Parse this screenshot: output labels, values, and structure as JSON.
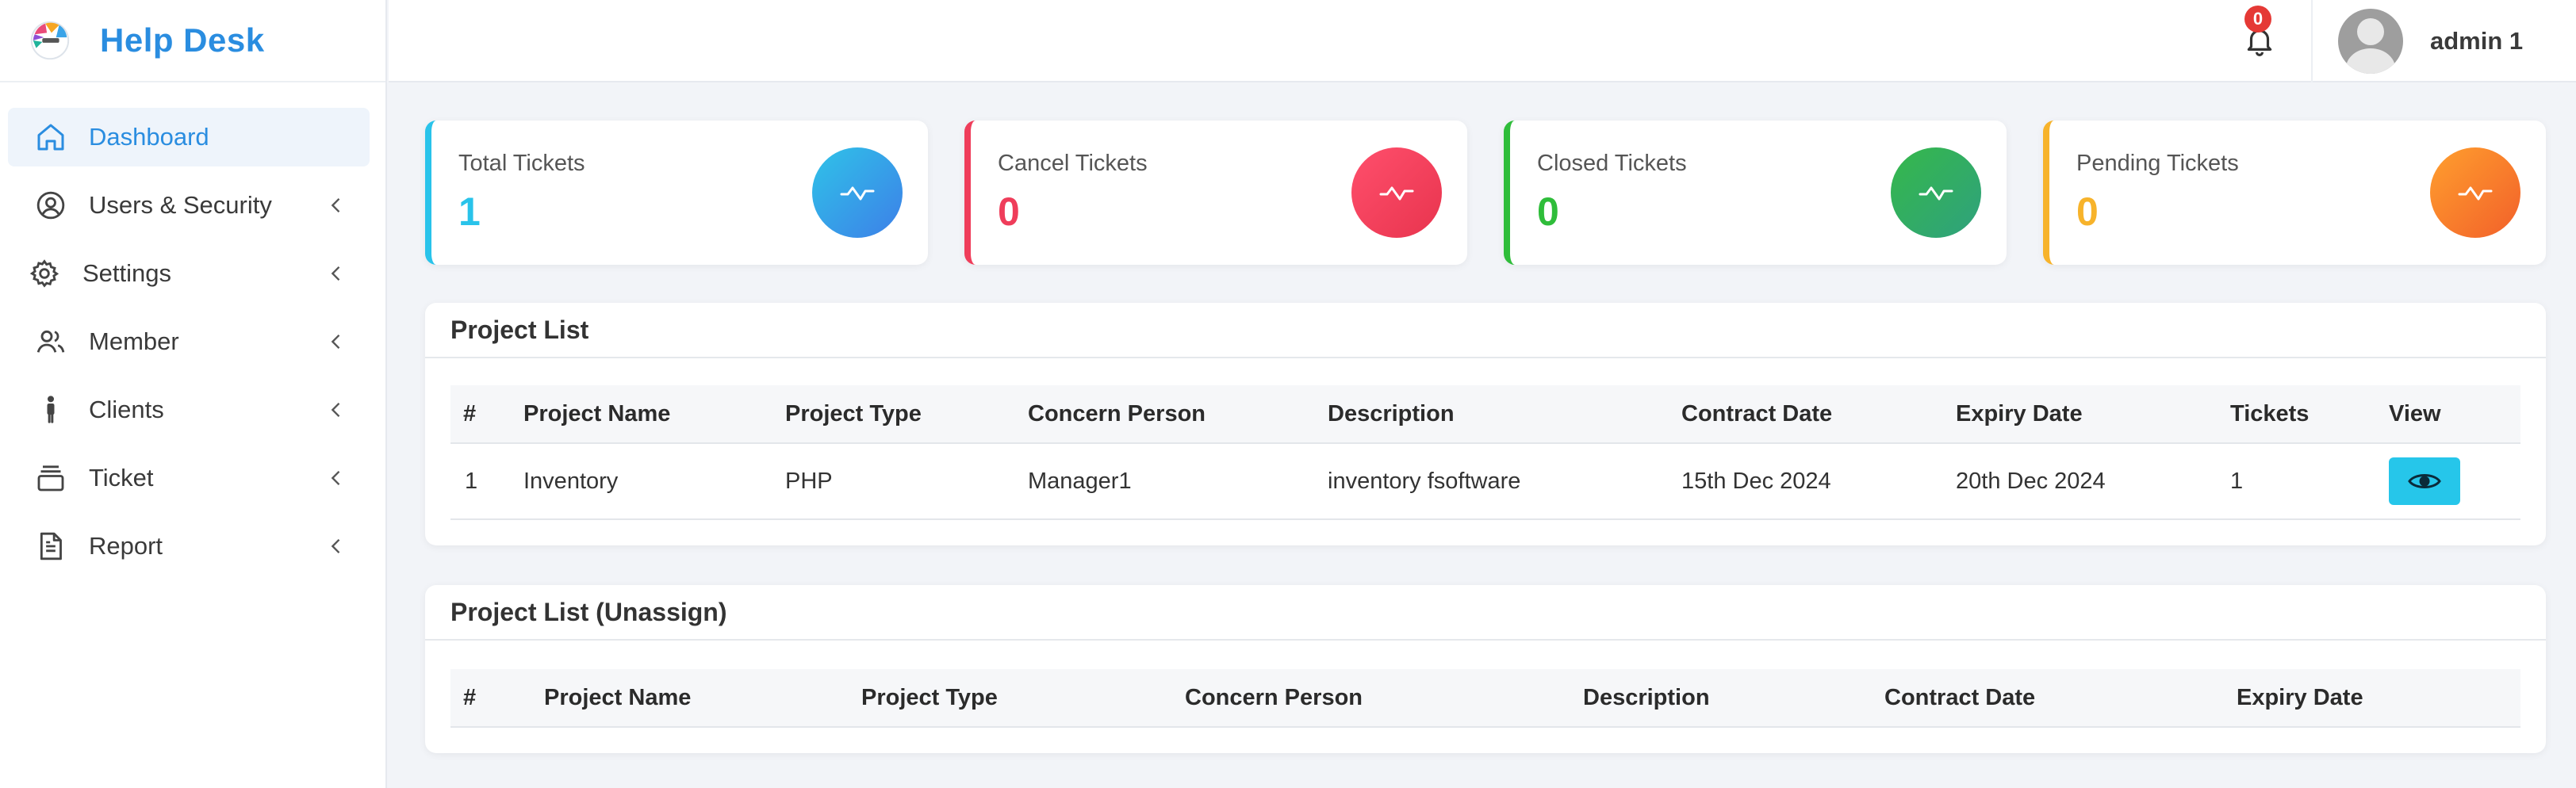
{
  "app": {
    "title": "Help Desk"
  },
  "sidebar": {
    "items": [
      {
        "label": "Dashboard",
        "icon": "home-icon",
        "active": true
      },
      {
        "label": "Users & Security",
        "icon": "user-circle-icon"
      },
      {
        "label": "Settings",
        "icon": "gear-icon"
      },
      {
        "label": "Member",
        "icon": "users-icon"
      },
      {
        "label": "Clients",
        "icon": "person-standing-icon"
      },
      {
        "label": "Ticket",
        "icon": "stack-icon"
      },
      {
        "label": "Report",
        "icon": "document-icon"
      }
    ]
  },
  "header": {
    "notifications_count": "0",
    "user_name": "admin 1"
  },
  "stats": [
    {
      "label": "Total Tickets",
      "value": "1",
      "color": "#29c3ea",
      "gradient": [
        "#2fc3e8",
        "#3d7fe8"
      ]
    },
    {
      "label": "Cancel Tickets",
      "value": "0",
      "color": "#ef3d5a",
      "gradient": [
        "#ff4f6c",
        "#e8344e"
      ]
    },
    {
      "label": "Closed Tickets",
      "value": "0",
      "color": "#2fbd3a",
      "gradient": [
        "#35b84a",
        "#2fa17e"
      ]
    },
    {
      "label": "Pending Tickets",
      "value": "0",
      "color": "#f7b32b",
      "gradient": [
        "#ff9f2e",
        "#f2602a"
      ]
    }
  ],
  "project_list": {
    "title": "Project List",
    "columns": [
      "#",
      "Project Name",
      "Project Type",
      "Concern Person",
      "Description",
      "Contract Date",
      "Expiry Date",
      "Tickets",
      "View"
    ],
    "rows": [
      {
        "num": "1",
        "name": "Inventory",
        "type": "PHP",
        "person": "Manager1",
        "description": "inventory fsoftware",
        "contract": "15th Dec 2024",
        "expiry": "20th Dec 2024",
        "tickets": "1"
      }
    ]
  },
  "project_list_unassign": {
    "title": "Project List (Unassign)",
    "columns": [
      "#",
      "Project Name",
      "Project Type",
      "Concern Person",
      "Description",
      "Contract Date",
      "Expiry Date"
    ]
  }
}
